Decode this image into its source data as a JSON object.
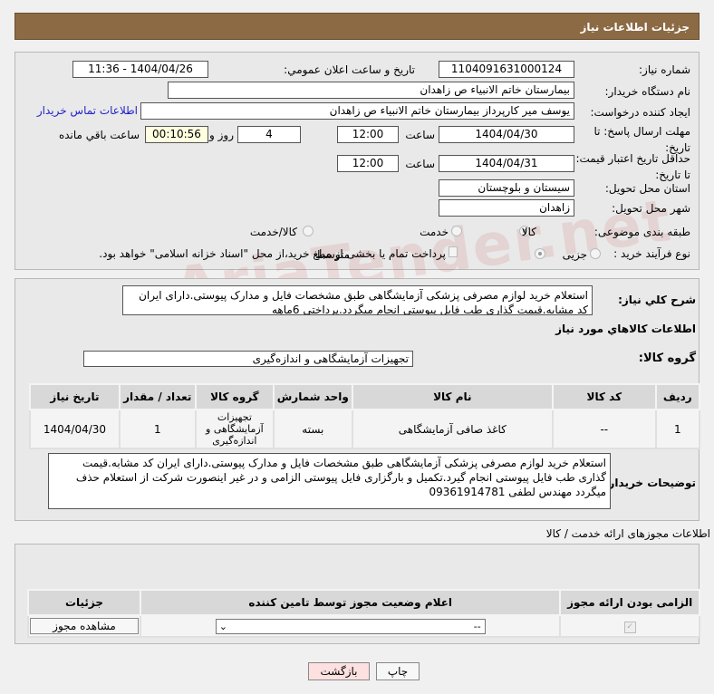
{
  "header": {
    "title": "جزئیات اطلاعات نیاز"
  },
  "form": {
    "need_number_label": "شماره نیاز:",
    "need_number": "1104091631000124",
    "announce_label": "تاریخ و ساعت اعلان عمومي:",
    "announce_value": "1404/04/26 - 11:36",
    "buyer_org_label": "نام دستگاه خریدار:",
    "buyer_org": "بیمارستان خاتم الانبیاء  ص  زاهدان",
    "creator_label": "ایجاد کننده درخواست:",
    "creator": "یوسف میر کارپرداز بیمارستان خاتم الانبیاء  ص  زاهدان",
    "contact_link": "اطلاعات تماس خریدار",
    "deadline_label": "مهلت ارسال پاسخ: تا تاریخ:",
    "deadline_date": "1404/04/30",
    "hour_label": "ساعت",
    "deadline_time": "12:00",
    "days": "4",
    "days_label": "روز و",
    "remaining": "00:10:56",
    "remaining_label": "ساعت باقي مانده",
    "validity_label": "حداقل تاریخ اعتبار قیمت: تا تاریخ:",
    "validity_date": "1404/04/31",
    "validity_time": "12:00",
    "province_label": "استان محل تحویل:",
    "province": "سیستان و بلوچستان",
    "city_label": "شهر محل تحویل:",
    "city": "زاهدان",
    "category_label": "طبقه بندی موضوعی:",
    "category_options": [
      "کالا",
      "خدمت",
      "کالا/خدمت"
    ],
    "purchase_type_label": "نوع فرآیند خرید :",
    "purchase_options": [
      "جزیی",
      "متوسط"
    ],
    "payment_note": "پرداخت تمام یا بخشی از مبلغ خرید،از محل \"اسناد خزانه اسلامی\" خواهد بود."
  },
  "details": {
    "desc_label": "شرح کلي نیاز:",
    "desc": "استعلام خرید لوازم مصرفی پزشکی آزمایشگاهی طبق مشخصات فایل و مدارک پیوستی.دارای ایران کد مشابه.قیمت گذاری طب فایل پیوستی انجام میگردد.پرداختی 6ماهه",
    "goods_heading": "اطلاعات کالاهاي مورد نیاز",
    "group_label": "گروه کالا:",
    "group": "تجهیزات آزمایشگاهی و اندازه‌گیری",
    "columns": [
      "ردیف",
      "کد کالا",
      "نام کالا",
      "واحد شمارش",
      "گروه کالا",
      "تعداد / مقدار",
      "تاریخ نیاز"
    ],
    "rows": [
      [
        "1",
        "--",
        "کاغذ صافی آزمایشگاهی",
        "بسته",
        "تجهیزات آزمایشگاهی و اندازه‌گیری",
        "1",
        "1404/04/30"
      ]
    ],
    "notes_label": "توضیحات خریدار:",
    "notes": "استعلام خرید لوازم مصرفی پزشکی آزمایشگاهی طبق مشخصات فایل و مدارک پیوستی.دارای ایران کد مشابه.قیمت گذاری طب فایل پیوستی انجام گیرد.تکمیل و بارگزاری فایل پیوستی الزامی و در غیر اینصورت شرکت از استعلام حذف میگردد مهندس لطفی 09361914781"
  },
  "permits": {
    "heading": "اطلاعات مجوزهای ارائه خدمت / کالا",
    "columns": [
      "الزامی بودن ارائه مجوز",
      "اعلام وضعیت مجوز توسط تامین کننده",
      "جزئیات"
    ],
    "select_value": "--",
    "view_button": "مشاهده مجوز"
  },
  "buttons": {
    "print": "چاپ",
    "back": "بازگشت"
  },
  "watermark": "AriaTender.net"
}
